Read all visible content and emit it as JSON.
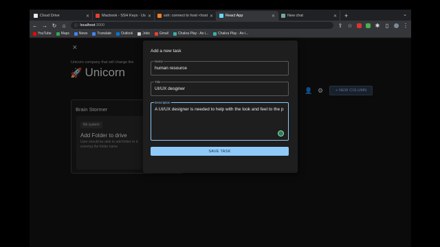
{
  "browser": {
    "tabs": [
      {
        "title": "Cloud Drive",
        "fav_color": "#e8e8e8",
        "active": false
      },
      {
        "title": "Macbook - SSH Keys · User Se",
        "fav_color": "#e2432a",
        "active": false
      },
      {
        "title": "ssh: connect to host <host> p",
        "fav_color": "#f48024",
        "active": false
      },
      {
        "title": "React App",
        "fav_color": "#61dafb",
        "active": true
      },
      {
        "title": "New chat",
        "fav_color": "#74aa9c",
        "active": false
      }
    ],
    "url_host": "localhost",
    "url_port": ":3000",
    "bookmarks": [
      {
        "label": "YouTube",
        "color": "#ff0000"
      },
      {
        "label": "Maps",
        "color": "#34a853"
      },
      {
        "label": "News",
        "color": "#4285f4"
      },
      {
        "label": "Translate",
        "color": "#4285f4"
      },
      {
        "label": "Outlook",
        "color": "#0078d4"
      },
      {
        "label": "Jobs",
        "color": "#cccccc"
      },
      {
        "label": "Gmail",
        "color": "#ea4335"
      },
      {
        "label": "Chakra Play - An i...",
        "color": "#38b2ac"
      },
      {
        "label": "Chakra Play - An i...",
        "color": "#38b2ac"
      }
    ]
  },
  "app": {
    "tagline": "Unicorn company that will change the",
    "brand_name": "Unicorn",
    "brand_emoji": "🚀",
    "new_column_label": "+ NEW COLUMN",
    "column": {
      "title": "Brain Stormer",
      "card": {
        "chip": "file system",
        "title": "Add Folder to drive",
        "description": "User should be able to add folder to d entering the folder name"
      }
    }
  },
  "modal": {
    "title": "Add a new task",
    "name_label": "Name",
    "name_value": "human resource",
    "title_label": "Title",
    "title_value": "UI/UX desginer",
    "description_label": "Description",
    "description_value": "A UI/UX designer is needed to help with the look and feel to the p",
    "save_label": "SAVE TASK"
  }
}
